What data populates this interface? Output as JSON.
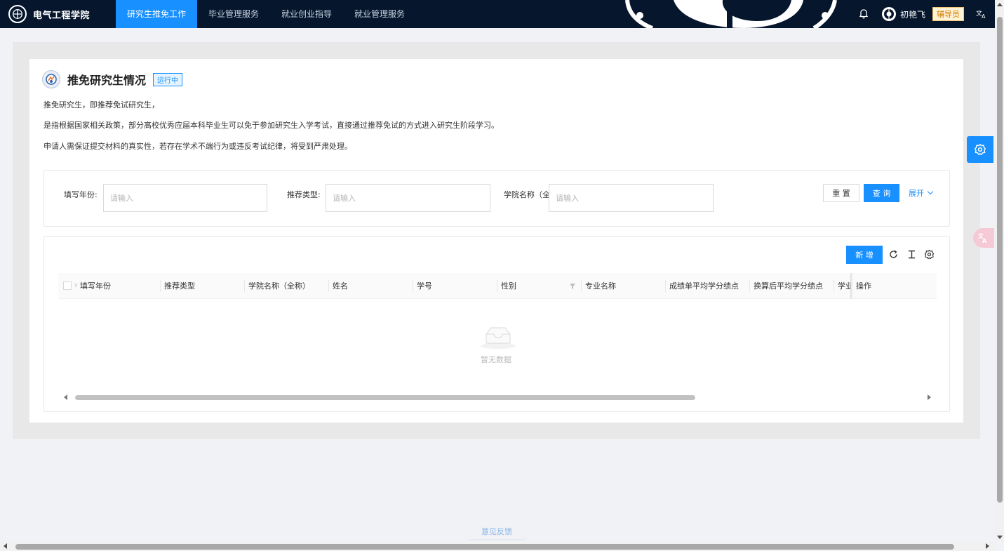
{
  "brand": {
    "name": "电气工程学院"
  },
  "nav": {
    "items": [
      {
        "label": "研究生推免工作",
        "active": true
      },
      {
        "label": "毕业管理服务",
        "active": false
      },
      {
        "label": "就业创业指导",
        "active": false
      },
      {
        "label": "就业管理服务",
        "active": false
      }
    ]
  },
  "user": {
    "name": "初艳飞",
    "role": "辅导员"
  },
  "page": {
    "title": "推免研究生情况",
    "status": "运行中",
    "desc": [
      "推免研究生，即推荐免试研究生，",
      "是指根据国家相关政策，部分高校优秀应届本科毕业生可以免于参加研究生入学考试，直接通过推荐免试的方式进入研究生阶段学习。",
      "申请人需保证提交材料的真实性，若存在学术不端行为或违反考试纪律，将受到严肃处理。"
    ]
  },
  "filter": {
    "year_label": "填写年份:",
    "type_label": "推荐类型:",
    "college_label": "学院名称（全",
    "placeholder": "请输入",
    "reset": "重 置",
    "query": "查 询",
    "expand": "展开"
  },
  "table": {
    "add": "新 增",
    "columns": [
      "填写年份",
      "推荐类型",
      "学院名称（全称）",
      "姓名",
      "学号",
      "性别",
      "专业名称",
      "成绩单平均学分绩点",
      "换算后平均学分绩点",
      "学业",
      "操作"
    ],
    "empty": "暂无数据"
  },
  "footer": {
    "feedback": "意见反馈"
  },
  "colors": {
    "primary": "#1890ff",
    "nav_bg": "#05162d"
  },
  "icons": [
    "bell-icon",
    "translate-icon",
    "refresh-icon",
    "column-height-icon",
    "settings-icon",
    "filter-icon",
    "empty-inbox-icon",
    "gear-icon"
  ]
}
